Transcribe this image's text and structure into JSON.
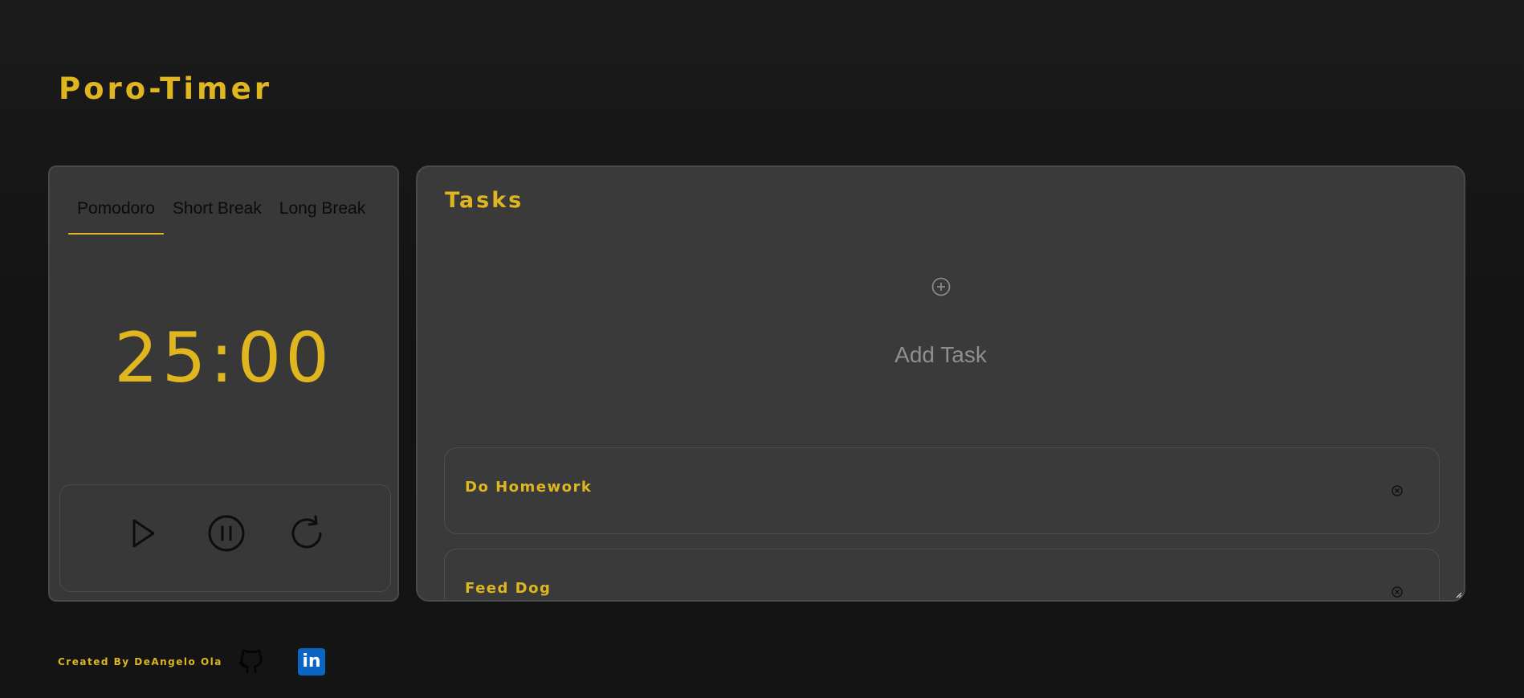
{
  "app": {
    "title": "Poro-Timer"
  },
  "colors": {
    "accent": "#dfb61f",
    "background": "#141415",
    "panel": "#3a3a3a",
    "panel_border": "#4a4a4a",
    "muted_text": "#8f8f8f",
    "linkedin_blue": "#0a66c2"
  },
  "timer": {
    "tabs": [
      {
        "label": "Pomodoro",
        "active": true
      },
      {
        "label": "Short Break",
        "active": false
      },
      {
        "label": "Long Break",
        "active": false
      }
    ],
    "display": "25:00",
    "controls": [
      {
        "icon": "play-icon"
      },
      {
        "icon": "pause-icon"
      },
      {
        "icon": "restart-icon"
      }
    ]
  },
  "tasks": {
    "heading": "Tasks",
    "add_icon": "plus-circle-icon",
    "add_label": "Add Task",
    "items": [
      {
        "name": "Do Homework",
        "remove_icon": "close-circle-icon"
      },
      {
        "name": "Feed Dog",
        "remove_icon": "close-circle-icon"
      }
    ]
  },
  "footer": {
    "credit": "Created By DeAngelo Ola",
    "links": [
      {
        "icon": "github-icon"
      },
      {
        "icon": "linkedin-icon",
        "glyph": "in"
      }
    ]
  }
}
